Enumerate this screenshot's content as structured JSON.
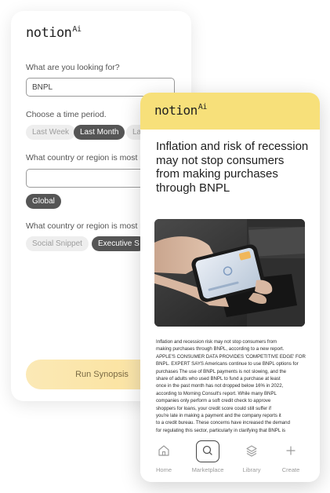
{
  "form_card": {
    "logo": {
      "text": "notion",
      "suffix": "Ai"
    },
    "q1": {
      "label": "What are you looking for?",
      "value": "BNPL"
    },
    "q2": {
      "label": "Choose a time period.",
      "options": [
        "Last Week",
        "Last Month",
        "Las"
      ],
      "selected": "Last Month"
    },
    "q3": {
      "label": "What country or region is most r",
      "value": "",
      "chip": "Global"
    },
    "q4": {
      "label": "What country or region is most r",
      "options": [
        "Social Snippet",
        "Executive S"
      ],
      "selected": "Executive S"
    },
    "run_button": "Run Synopsis"
  },
  "article_card": {
    "logo": {
      "text": "notion",
      "suffix": "Ai"
    },
    "header_color": "#f7e07a",
    "title": "Inflation and risk of recession may not stop consumers from making purchases through BNPL",
    "body_lines": [
      "Inflation and recession risk may not stop consumers from",
      "making purchases through BNPL, according to a new report.",
      "APPLE'S CONSUMER DATA PROVIDES 'COMPETITIVE EDGE' FOR",
      "BNPL. EXPERT SAYS Americans continue to use BNPL options for",
      "purchases The use of BNPL payments is not slowing, and the",
      "share of adults who used BNPL to fund a purchase at least",
      "once in the past month has not dropped below 16% in 2022,",
      "according to Morning Consult's report. While many BNPL",
      "companies only perform a soft credit check to approve",
      "shoppers for loans, your credit score could still suffer if",
      "you're late in making a payment and the company reports it",
      "to a credit bureau. These concerns have increased the demand",
      "for regulating this sector, particularly in clarifying that BNPL is"
    ],
    "nav": [
      {
        "label": "Home",
        "icon": "home-icon"
      },
      {
        "label": "Marketplace",
        "icon": "search-icon",
        "active": true
      },
      {
        "label": "Library",
        "icon": "layers-icon"
      },
      {
        "label": "Create",
        "icon": "plus-icon"
      }
    ]
  }
}
